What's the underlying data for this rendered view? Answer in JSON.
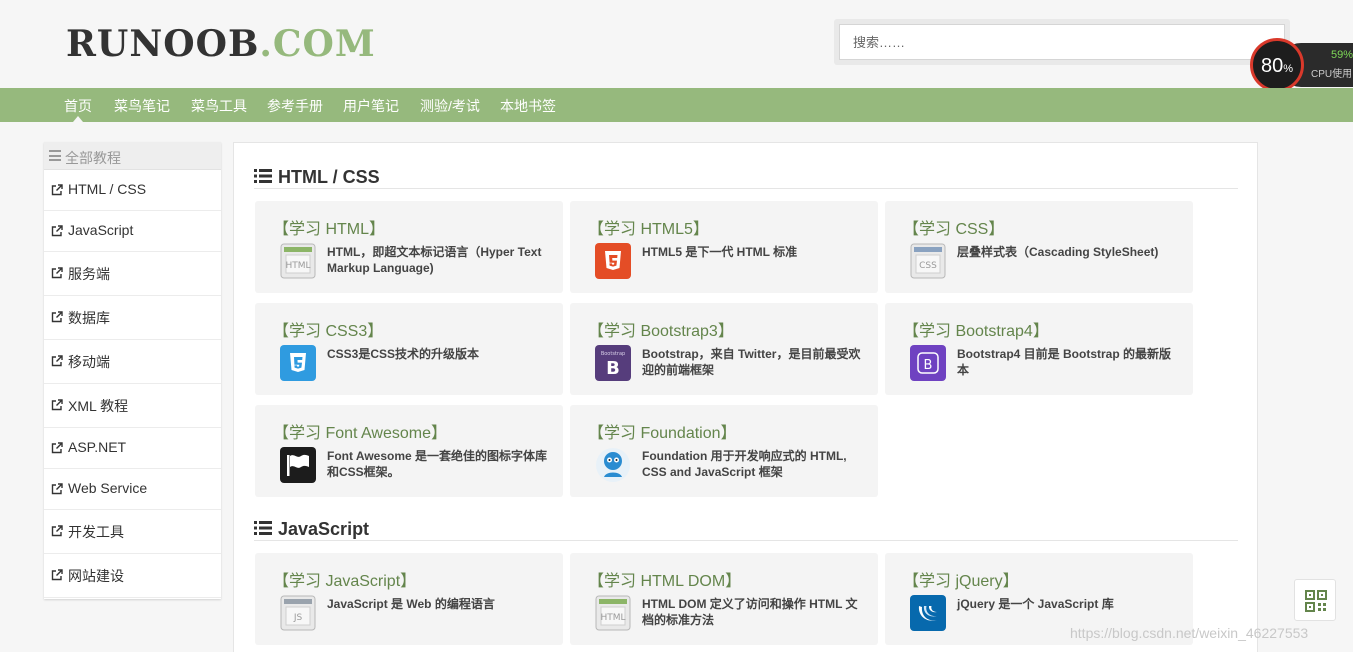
{
  "logo": {
    "part1": "RUNOOB",
    "part2": ".COM"
  },
  "search": {
    "placeholder": "搜索……"
  },
  "cpu_widget": {
    "value": "80",
    "unit": "%",
    "side_percent": "59%",
    "side_label": "CPU使用"
  },
  "nav": {
    "items": [
      "首页",
      "菜鸟笔记",
      "菜鸟工具",
      "参考手册",
      "用户笔记",
      "测验/考试",
      "本地书签"
    ]
  },
  "sidebar": {
    "header": "全部教程",
    "items": [
      "HTML / CSS",
      "JavaScript",
      "服务端",
      "数据库",
      "移动端",
      "XML 教程",
      "ASP.NET",
      "Web Service",
      "开发工具",
      "网站建设"
    ]
  },
  "sections": [
    {
      "title": "HTML / CSS",
      "cards": [
        {
          "title": "【学习 HTML】",
          "desc": "HTML，即超文本标记语言（Hyper Text Markup Language)",
          "icon": "html-icon"
        },
        {
          "title": "【学习 HTML5】",
          "desc": "HTML5 是下一代 HTML 标准",
          "icon": "html5-icon"
        },
        {
          "title": "【学习 CSS】",
          "desc": "层叠样式表（Cascading StyleSheet)",
          "icon": "css-icon"
        },
        {
          "title": "【学习 CSS3】",
          "desc": "CSS3是CSS技术的升级版本",
          "icon": "css3-icon"
        },
        {
          "title": "【学习 Bootstrap3】",
          "desc": "Bootstrap，来自 Twitter，是目前最受欢迎的前端框架",
          "icon": "bootstrap3-icon"
        },
        {
          "title": "【学习 Bootstrap4】",
          "desc": "Bootstrap4 目前是 Bootstrap 的最新版本",
          "icon": "bootstrap4-icon"
        },
        {
          "title": "【学习 Font Awesome】",
          "desc": "Font Awesome 是一套绝佳的图标字体库和CSS框架。",
          "icon": "font-awesome-icon"
        },
        {
          "title": "【学习 Foundation】",
          "desc": "Foundation 用于开发响应式的 HTML, CSS and JavaScript 框架",
          "icon": "foundation-icon"
        }
      ]
    },
    {
      "title": "JavaScript",
      "cards": [
        {
          "title": "【学习 JavaScript】",
          "desc": "JavaScript 是 Web 的编程语言",
          "icon": "javascript-icon"
        },
        {
          "title": "【学习 HTML DOM】",
          "desc": "HTML DOM 定义了访问和操作 HTML 文档的标准方法",
          "icon": "html-dom-icon"
        },
        {
          "title": "【学习 jQuery】",
          "desc": "jQuery 是一个 JavaScript 库",
          "icon": "jquery-icon"
        }
      ]
    }
  ],
  "watermark": "https://blog.csdn.net/weixin_46227553",
  "colors": {
    "accent": "#96b97d",
    "card_title": "#64854c",
    "card_bg": "#f4f4f4"
  }
}
